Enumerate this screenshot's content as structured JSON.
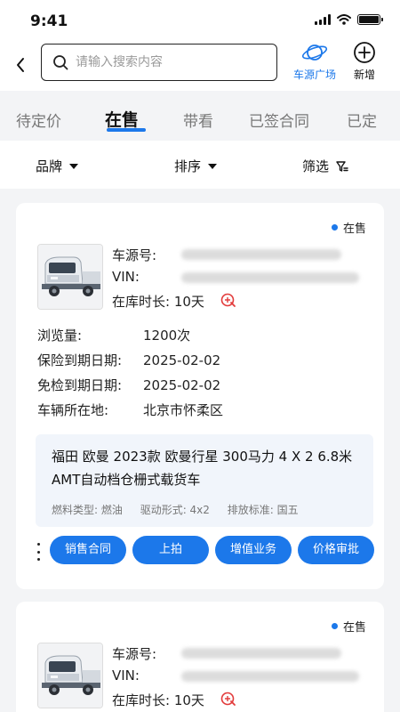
{
  "status_bar": {
    "time": "9:41"
  },
  "header": {
    "back_icon": "chevron-left-icon",
    "search": {
      "placeholder": "请输入搜索内容",
      "value": ""
    },
    "market_label": "车源广场",
    "add_label": "新增"
  },
  "colors": {
    "accent": "#1c78ea",
    "desc_bg": "#f1f5fb",
    "tag_red": "#e23b3b"
  },
  "tabs": [
    {
      "label": "待定价",
      "active": false
    },
    {
      "label": "在售",
      "active": true
    },
    {
      "label": "带看",
      "active": false
    },
    {
      "label": "已签合同",
      "active": false
    },
    {
      "label": "已定",
      "active": false
    }
  ],
  "filters": {
    "brand": "品牌",
    "sort": "排序",
    "filter": "筛选"
  },
  "cards": [
    {
      "status": "在售",
      "source_label": "车源号:",
      "vin_label": "VIN:",
      "stock_label": "在库时长: 10天",
      "views_label": "浏览量:",
      "views_value": "1200次",
      "insurance_label": "保险到期日期:",
      "insurance_value": "2025-02-02",
      "inspection_label": "免检到期日期:",
      "inspection_value": "2025-02-02",
      "location_label": "车辆所在地:",
      "location_value": "北京市怀柔区",
      "title": "福田 欧曼 2023款 欧曼行星 300马力 4 X 2 6.8米AMT自动档仓栅式载货车",
      "fuel": "燃料类型: 燃油",
      "drive": "驱动形式: 4x2",
      "emission": "排放标准: 国五",
      "actions": [
        "销售合同",
        "上拍",
        "增值业务",
        "价格审批"
      ]
    },
    {
      "status": "在售",
      "source_label": "车源号:",
      "vin_label": "VIN:",
      "stock_label": "在库时长: 10天"
    }
  ]
}
